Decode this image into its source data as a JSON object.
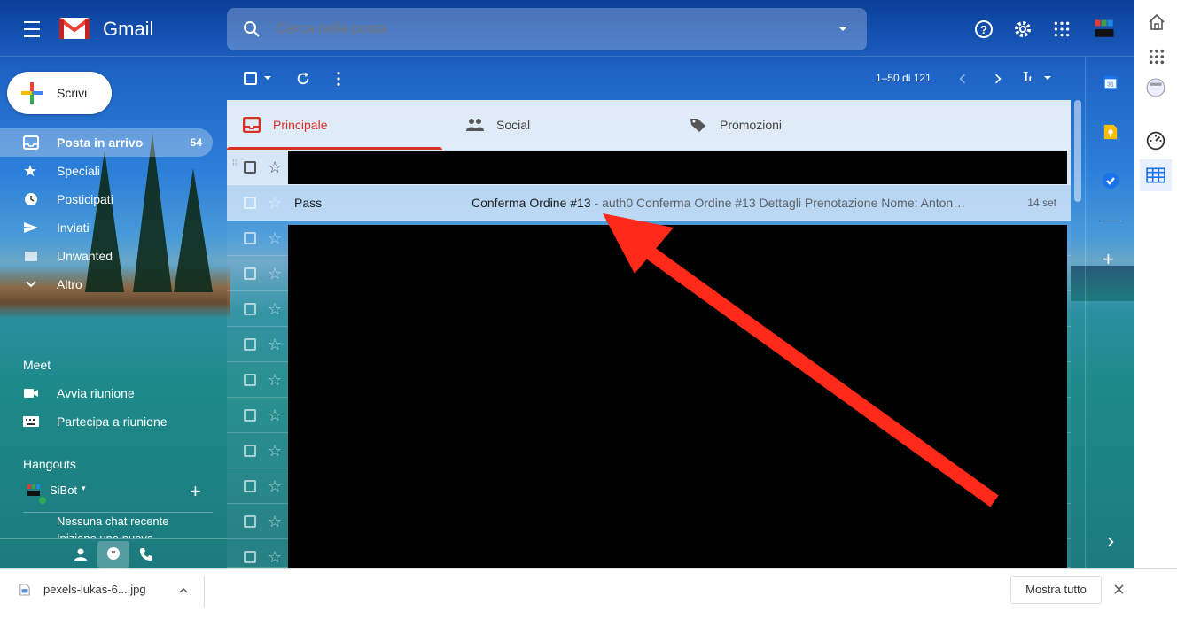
{
  "app": {
    "brand": "Gmail"
  },
  "search": {
    "placeholder": "Cerca nella posta"
  },
  "compose": {
    "label": "Scrivi"
  },
  "nav": {
    "items": [
      {
        "label": "Posta in arrivo",
        "count": "54"
      },
      {
        "label": "Speciali",
        "count": ""
      },
      {
        "label": "Posticipati",
        "count": ""
      },
      {
        "label": "Inviati",
        "count": ""
      },
      {
        "label": "Unwanted",
        "count": ""
      },
      {
        "label": "Altro",
        "count": ""
      }
    ]
  },
  "meet": {
    "title": "Meet",
    "start": "Avvia riunione",
    "join": "Partecipa a riunione"
  },
  "hangouts": {
    "title": "Hangouts",
    "user": "SiBot",
    "user_caret": "▾",
    "empty1": "Nessuna chat recente",
    "empty2": "Iniziane una nuova"
  },
  "toolbar": {
    "pagination": "1–50 di 121"
  },
  "tabs": [
    {
      "label": "Principale"
    },
    {
      "label": "Social"
    },
    {
      "label": "Promozioni"
    }
  ],
  "email": {
    "sender": "Pass",
    "subject": "Conferma Ordine #13",
    "snippet": " - auth0 Conferma Ordine #13 Dettagli Prenotazione Nome: Anton…",
    "date": "14 set"
  },
  "download": {
    "file": "pexels-lukas-6....jpg",
    "show_all": "Mostra tutto"
  },
  "annotation": {
    "arrow_color": "#ff2a1a"
  },
  "icons": [
    "menu-icon",
    "gmail-logo",
    "search-icon",
    "help-icon",
    "gear-icon",
    "apps-icon",
    "avatar",
    "inbox-icon",
    "star-icon",
    "clock-icon",
    "send-icon",
    "report-icon",
    "chevron-down-icon",
    "refresh-icon",
    "more-vert-icon",
    "chevron-left-icon",
    "chevron-right-icon",
    "input-tools-icon",
    "people-icon",
    "tag-icon",
    "calendar-icon",
    "keep-icon",
    "tasks-icon",
    "plus-icon",
    "home-icon",
    "download-file-icon",
    "close-icon"
  ]
}
